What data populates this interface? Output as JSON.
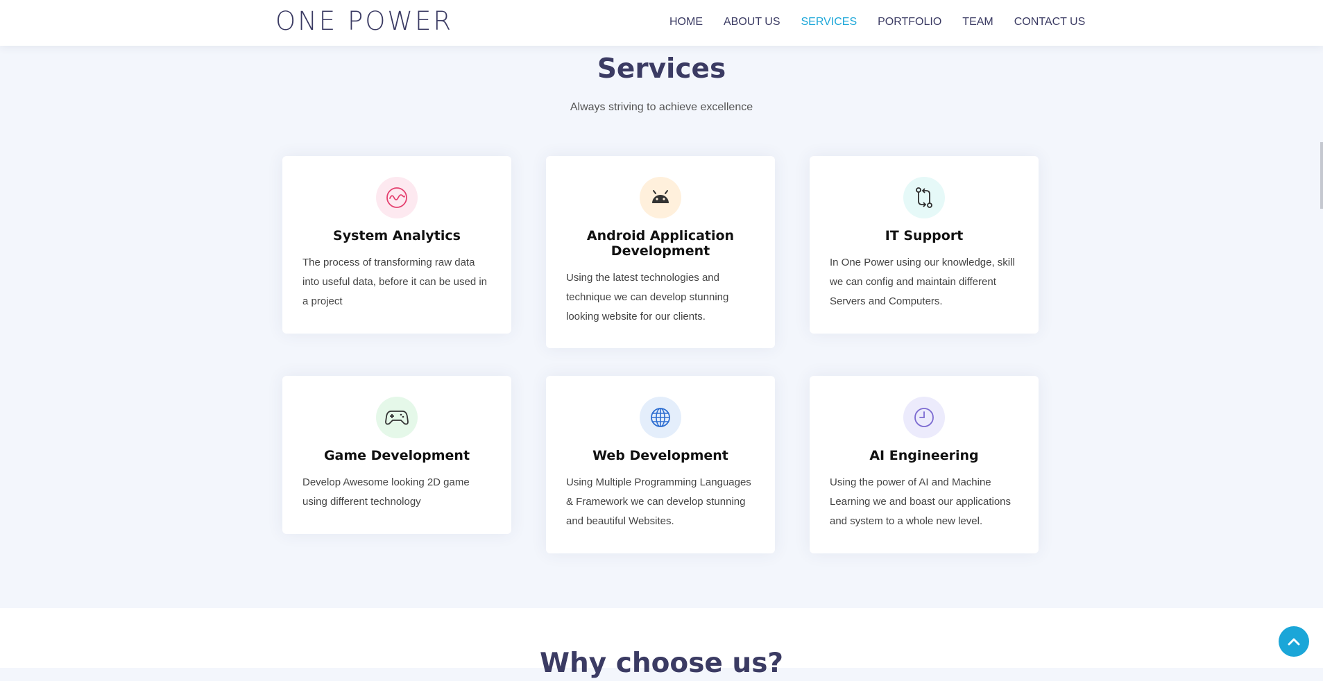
{
  "navbar": {
    "logo": "ONE POWER",
    "links": [
      {
        "label": "HOME",
        "active": false
      },
      {
        "label": "ABOUT US",
        "active": false
      },
      {
        "label": "SERVICES",
        "active": true
      },
      {
        "label": "PORTFOLIO",
        "active": false
      },
      {
        "label": "TEAM",
        "active": false
      },
      {
        "label": "CONTACT US",
        "active": false
      }
    ]
  },
  "services": {
    "title": "Services",
    "subtitle": "Always striving to achieve excellence",
    "cards": [
      {
        "icon": "activity-icon",
        "icon_color": "#e4406f",
        "bg": "#fde9f0",
        "title": "System Analytics",
        "text": "The process of transforming raw data into useful data, before it can be used in a project"
      },
      {
        "icon": "android-icon",
        "icon_color": "#333333",
        "bg": "#fff0dc",
        "title": "Android Application Development",
        "text": "Using the latest technologies and technique we can develop stunning looking website for our clients."
      },
      {
        "icon": "git-compare-icon",
        "icon_color": "#2d2d2d",
        "bg": "#e6f9f8",
        "title": "IT Support",
        "text": "In One Power using our knowledge, skill we can config and maintain different Servers and Computers."
      },
      {
        "icon": "gamepad-icon",
        "icon_color": "#333333",
        "bg": "#e5f8e9",
        "title": "Game Development",
        "text": "Develop Awesome looking 2D game using different technology"
      },
      {
        "icon": "globe-icon",
        "icon_color": "#2f6fd1",
        "bg": "#e4eefb",
        "title": "Web Development",
        "text": "Using Multiple Programming Languages & Framework we can develop stunning and beautiful Websites."
      },
      {
        "icon": "clock-icon",
        "icon_color": "#7b6ad1",
        "bg": "#ecebfc",
        "title": "AI Engineering",
        "text": "Using the power of AI and Machine Learning we and boast our applications and system to a whole new level."
      }
    ]
  },
  "why": {
    "title": "Why choose us?"
  }
}
